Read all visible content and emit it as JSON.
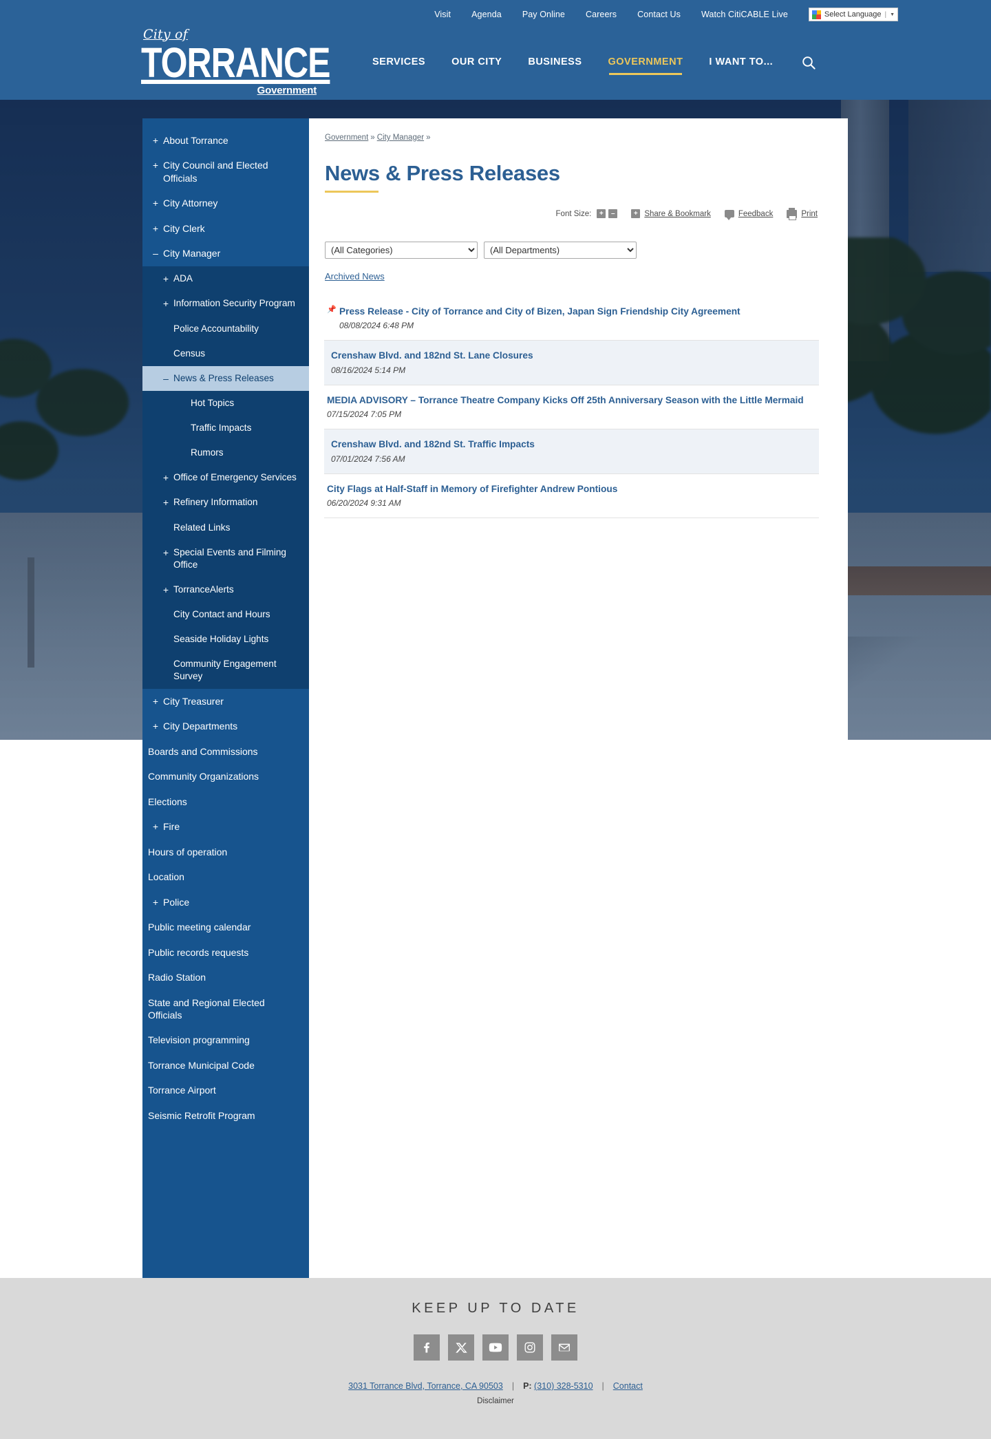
{
  "topbar": {
    "links": [
      {
        "label": "Visit"
      },
      {
        "label": "Agenda"
      },
      {
        "label": "Pay Online"
      },
      {
        "label": "Careers"
      },
      {
        "label": "Contact Us"
      },
      {
        "label": "Watch CitiCABLE Live"
      }
    ],
    "language_widget": {
      "label": "Select Language",
      "separator": "|",
      "caret": "▼"
    }
  },
  "header": {
    "logo": {
      "line1": "City of",
      "line2": "TORRANCE",
      "line3": "Government"
    },
    "nav": [
      {
        "label": "SERVICES",
        "active": false
      },
      {
        "label": "OUR CITY",
        "active": false
      },
      {
        "label": "BUSINESS",
        "active": false
      },
      {
        "label": "GOVERNMENT",
        "active": true
      },
      {
        "label": "I WANT TO...",
        "active": false
      }
    ],
    "search_icon": "search-icon",
    "accent_color": "#edc75a",
    "brand_color": "#2b6298"
  },
  "sidebar": {
    "items": [
      {
        "label": "About Torrance",
        "toggle": "+",
        "level": 1
      },
      {
        "label": "City Council and Elected Officials",
        "toggle": "+",
        "level": 1
      },
      {
        "label": "City Attorney",
        "toggle": "+",
        "level": 1
      },
      {
        "label": "City Clerk",
        "toggle": "+",
        "level": 1
      },
      {
        "label": "City Manager",
        "toggle": "–",
        "level": 1
      },
      {
        "label": "ADA",
        "toggle": "+",
        "level": 2,
        "dark": true
      },
      {
        "label": "Information Security Program",
        "toggle": "+",
        "level": 2,
        "dark": true
      },
      {
        "label": "Police Accountability",
        "toggle": "",
        "level": 2,
        "dark": true
      },
      {
        "label": "Census",
        "toggle": "",
        "level": 2,
        "dark": true
      },
      {
        "label": "News & Press Releases",
        "toggle": "–",
        "level": 2,
        "active": true
      },
      {
        "label": "Hot Topics",
        "toggle": "",
        "level": 3,
        "dark": true
      },
      {
        "label": "Traffic Impacts",
        "toggle": "",
        "level": 3,
        "dark": true
      },
      {
        "label": "Rumors",
        "toggle": "",
        "level": 3,
        "dark": true
      },
      {
        "label": "Office of Emergency Services",
        "toggle": "+",
        "level": 2,
        "dark": true
      },
      {
        "label": "Refinery Information",
        "toggle": "+",
        "level": 2,
        "dark": true
      },
      {
        "label": "Related Links",
        "toggle": "",
        "level": 2,
        "dark": true
      },
      {
        "label": "Special Events and Filming Office",
        "toggle": "+",
        "level": 2,
        "dark": true
      },
      {
        "label": "TorranceAlerts",
        "toggle": "+",
        "level": 2,
        "dark": true
      },
      {
        "label": "City Contact and Hours",
        "toggle": "",
        "level": 2,
        "dark": true
      },
      {
        "label": "Seaside Holiday Lights",
        "toggle": "",
        "level": 2,
        "dark": true
      },
      {
        "label": "Community Engagement Survey",
        "toggle": "",
        "level": 2,
        "dark": true
      },
      {
        "label": "City Treasurer",
        "toggle": "+",
        "level": 1
      },
      {
        "label": "City Departments",
        "toggle": "+",
        "level": 1
      },
      {
        "label": "Boards and Commissions",
        "toggle": "",
        "level": 1
      },
      {
        "label": "Community Organizations",
        "toggle": "",
        "level": 1
      },
      {
        "label": "Elections",
        "toggle": "",
        "level": 1
      },
      {
        "label": "Fire",
        "toggle": "+",
        "level": 1
      },
      {
        "label": "Hours of operation",
        "toggle": "",
        "level": 1
      },
      {
        "label": "Location",
        "toggle": "",
        "level": 1
      },
      {
        "label": "Police",
        "toggle": "+",
        "level": 1
      },
      {
        "label": "Public meeting calendar",
        "toggle": "",
        "level": 1
      },
      {
        "label": "Public records requests",
        "toggle": "",
        "level": 1
      },
      {
        "label": "Radio Station",
        "toggle": "",
        "level": 1
      },
      {
        "label": "State and Regional Elected Officials",
        "toggle": "",
        "level": 1
      },
      {
        "label": "Television programming",
        "toggle": "",
        "level": 1
      },
      {
        "label": "Torrance Municipal Code",
        "toggle": "",
        "level": 1
      },
      {
        "label": "Torrance Airport",
        "toggle": "",
        "level": 1
      },
      {
        "label": "Seismic Retrofit Program",
        "toggle": "",
        "level": 1
      }
    ]
  },
  "main": {
    "breadcrumb": [
      {
        "label": "Government",
        "link": true
      },
      {
        "label": "City Manager",
        "link": true
      }
    ],
    "breadcrumb_separator": "»",
    "title": "News & Press Releases",
    "toolbar": {
      "font_size_label": "Font Size:",
      "font_increase": "+",
      "font_decrease": "–",
      "share_plus": "+",
      "share_label": "Share & Bookmark",
      "feedback_label": "Feedback",
      "print_label": "Print"
    },
    "filters": {
      "category_selected": "(All Categories)",
      "category_options": [
        "(All Categories)"
      ],
      "department_selected": "(All Departments)",
      "department_options": [
        "(All Departments)"
      ]
    },
    "archived_link": "Archived News",
    "news": [
      {
        "pinned": true,
        "pin_icon": "pushpin-icon",
        "title": "Press Release - City of Torrance and City of Bizen, Japan Sign Friendship City Agreement",
        "date": "08/08/2024 6:48 PM"
      },
      {
        "pinned": false,
        "title": "Crenshaw Blvd. and 182nd St. Lane Closures",
        "date": "08/16/2024 5:14 PM"
      },
      {
        "pinned": false,
        "title": "MEDIA ADVISORY – Torrance Theatre Company Kicks Off 25th Anniversary Season with the Little Mermaid",
        "date": "07/15/2024 7:05 PM"
      },
      {
        "pinned": false,
        "title": "Crenshaw Blvd. and 182nd St. Traffic Impacts",
        "date": "07/01/2024 7:56 AM"
      },
      {
        "pinned": false,
        "title": "City Flags at Half-Staff in Memory of Firefighter Andrew Pontious",
        "date": "06/20/2024 9:31 AM"
      }
    ]
  },
  "footer": {
    "title": "KEEP UP TO DATE",
    "social": [
      {
        "name": "facebook-icon"
      },
      {
        "name": "x-twitter-icon"
      },
      {
        "name": "youtube-icon"
      },
      {
        "name": "instagram-icon"
      },
      {
        "name": "email-icon"
      }
    ],
    "address": "3031 Torrance Blvd, Torrance, CA 90503",
    "phone_prefix": "P:",
    "phone": "(310) 328-5310",
    "contact_label": "Contact",
    "separator": "|",
    "disclaimer": "Disclaimer"
  }
}
